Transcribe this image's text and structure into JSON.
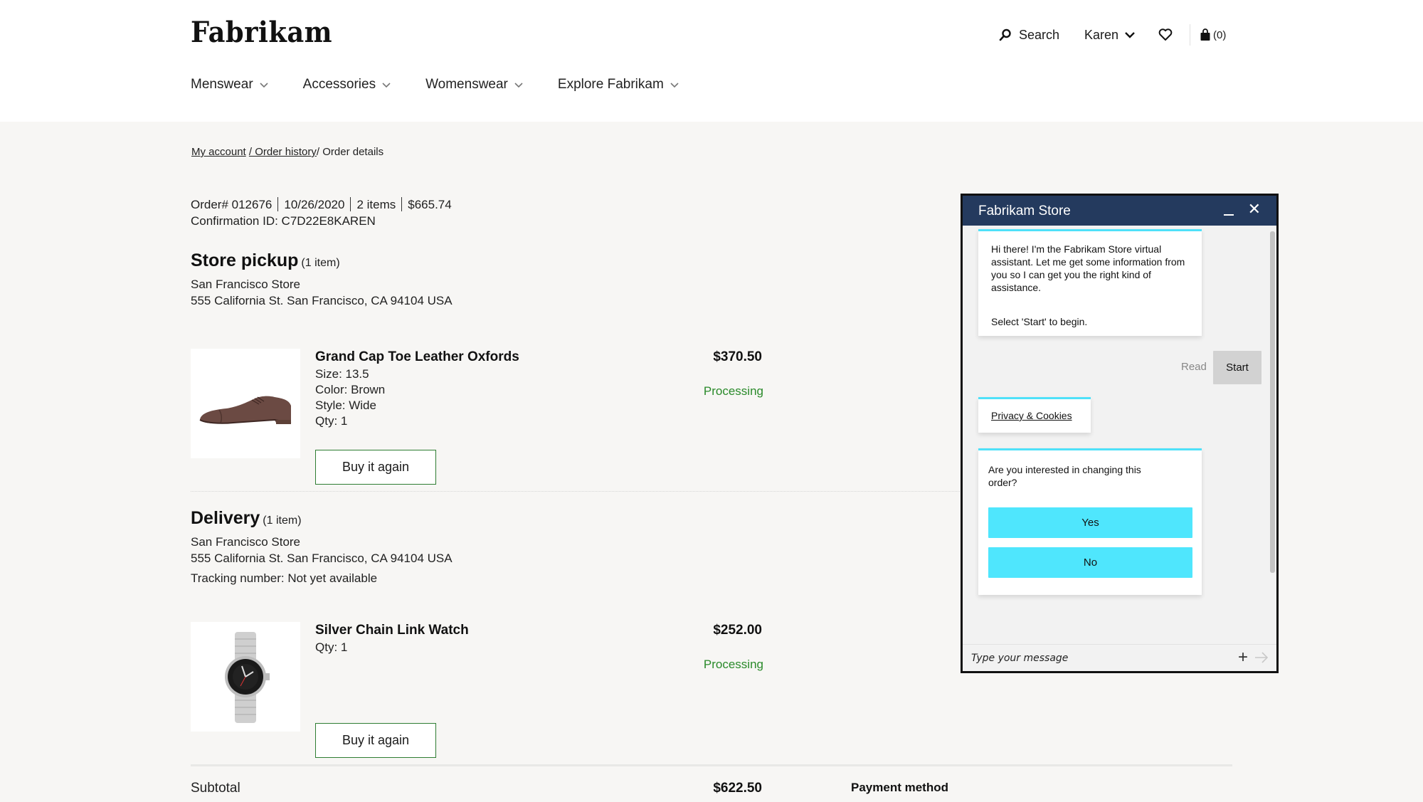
{
  "header": {
    "logo": "Fabrikam",
    "search_label": "Search",
    "user_label": "Karen",
    "cart_count": "(0)",
    "nav": [
      {
        "label": "Menswear"
      },
      {
        "label": "Accessories"
      },
      {
        "label": "Womenswear"
      },
      {
        "label": "Explore Fabrikam"
      }
    ]
  },
  "breadcrumb": {
    "items": [
      "My account",
      " / Order history",
      "/ Order details"
    ]
  },
  "order": {
    "number": "Order# 012676",
    "date": "10/26/2020",
    "item_count": "2 items",
    "total": "$665.74",
    "confirmation": "Confirmation ID: C7D22E8KAREN"
  },
  "pickup": {
    "title": "Store pickup",
    "count": "(1 item)",
    "store": "San Francisco Store",
    "address": "555 California St. San Francisco, CA 94104 USA",
    "item": {
      "name": "Grand Cap Toe Leather Oxfords",
      "attrs": [
        "Size: 13.5",
        "Color: Brown",
        "Style: Wide",
        "Qty: 1"
      ],
      "price": "$370.50",
      "status": "Processing",
      "button": "Buy it again",
      "image": "brown-oxford-shoe"
    }
  },
  "delivery": {
    "title": "Delivery",
    "count": "(1 item)",
    "store": "San Francisco Store",
    "address": "555 California St. San Francisco, CA 94104 USA",
    "tracking": "Tracking number: Not yet available",
    "item": {
      "name": "Silver Chain Link Watch",
      "attrs": [
        "Qty: 1"
      ],
      "price": "$252.00",
      "status": "Processing",
      "button": "Buy it again",
      "image": "silver-watch"
    }
  },
  "summary": {
    "subtotal_label": "Subtotal",
    "subtotal_value": "$622.50",
    "payment_label": "Payment method"
  },
  "chat": {
    "title": "Fabrikam Store",
    "greeting": "Hi there! I'm the Fabrikam Store virtual assistant. Let me get some information from you so I can get you the right kind of assistance.",
    "instruction": "Select 'Start' to begin.",
    "read_label": "Read",
    "start_label": "Start",
    "privacy_link": "Privacy & Cookies",
    "question": "Are you interested in changing this order?",
    "yes_label": "Yes",
    "no_label": "No",
    "input_placeholder": "Type your message",
    "accent_color": "#4fe6fd",
    "header_color": "#243a5e"
  },
  "colors": {
    "status_processing": "#2a8a2a",
    "button_border": "#2e7d32"
  }
}
